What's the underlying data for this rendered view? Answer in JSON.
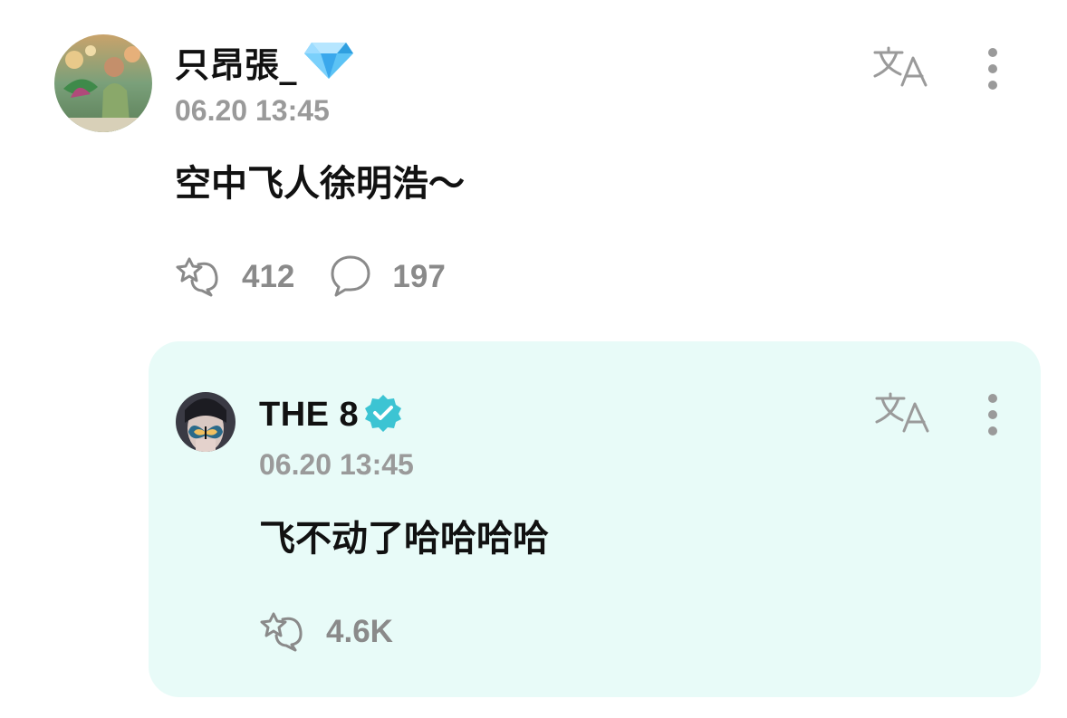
{
  "post": {
    "author": "只昂張_",
    "badge_icon": "diamond-icon",
    "time": "06.20 13:45",
    "text": "空中飞人徐明浩～",
    "likes": "412",
    "comments": "197",
    "translate_icon": "translate-icon",
    "more_icon": "more-options-icon"
  },
  "reply": {
    "author": "THE 8",
    "badge_icon": "verified-icon",
    "time": "06.20 13:45",
    "text": "飞不动了哈哈哈哈",
    "likes": "4.6K",
    "translate_icon": "translate-icon",
    "more_icon": "more-options-icon"
  },
  "colors": {
    "reply_background": "#e8fbf8",
    "muted_text": "#9a9a9a",
    "verified": "#3cc4d3",
    "diamond": "#4fb3f0"
  }
}
